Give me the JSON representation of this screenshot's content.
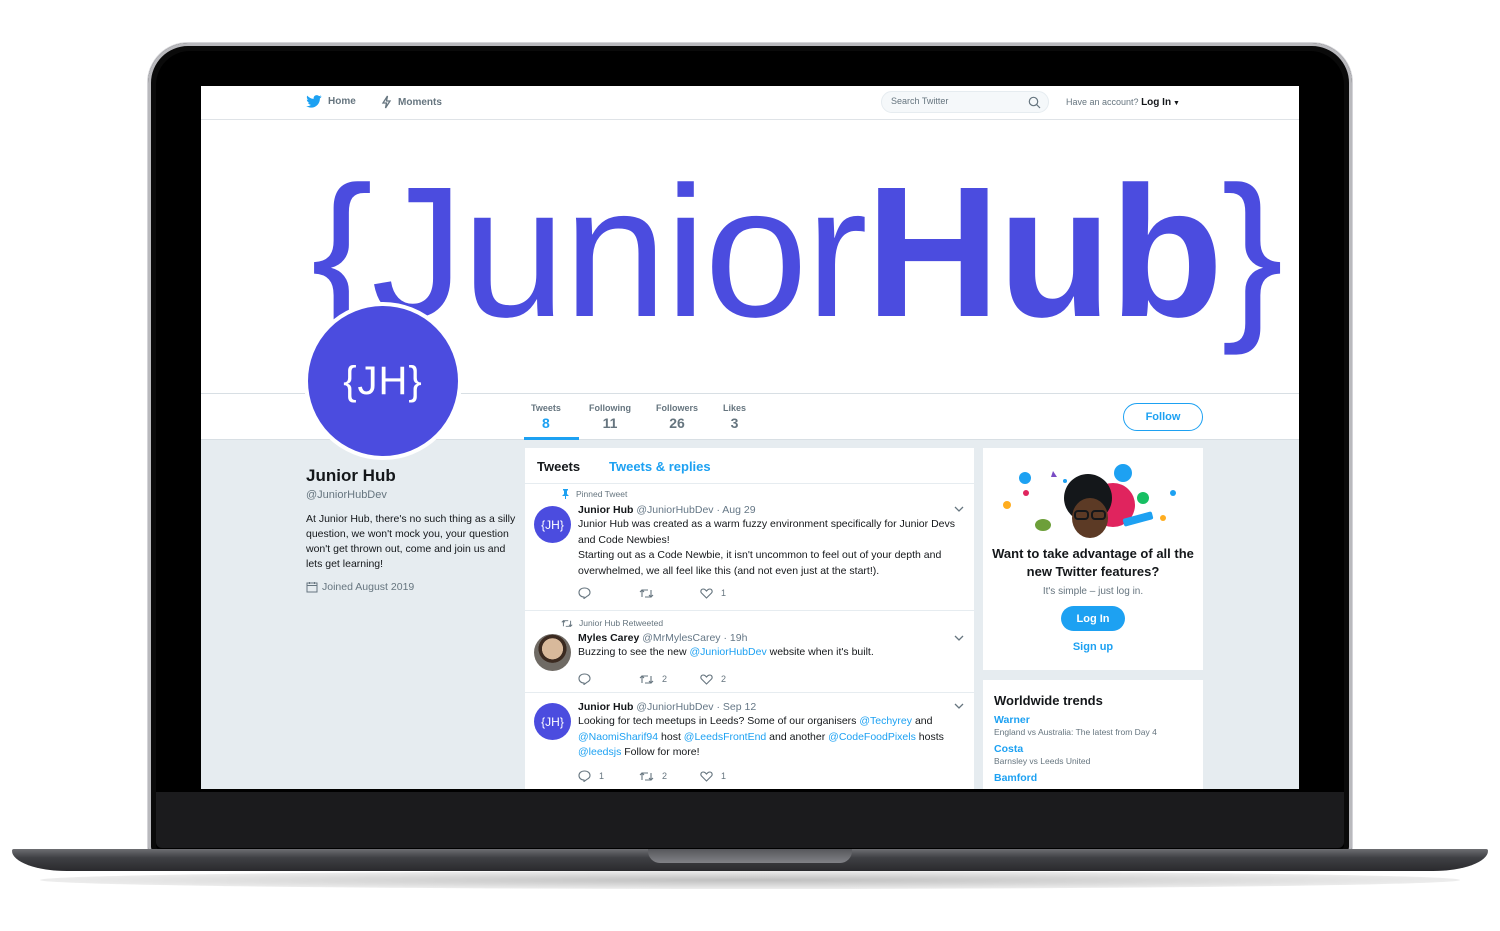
{
  "nav": {
    "home": "Home",
    "moments": "Moments",
    "search_placeholder": "Search Twitter",
    "have_account": "Have an account?",
    "login": "Log In"
  },
  "banner": {
    "brace_open": "{",
    "word_light": "Junior",
    "word_bold": "Hub",
    "brace_close": "}"
  },
  "avatar": {
    "text": "{JH}"
  },
  "profile": {
    "name": "Junior Hub",
    "handle": "@JuniorHubDev",
    "bio": "At Junior Hub, there's no such thing as a silly question, we won't mock you, your question won't get thrown out, come and join us and lets get learning!",
    "joined": "Joined August 2019"
  },
  "stats": [
    {
      "label": "Tweets",
      "value": "8"
    },
    {
      "label": "Following",
      "value": "11"
    },
    {
      "label": "Followers",
      "value": "26"
    },
    {
      "label": "Likes",
      "value": "3"
    }
  ],
  "follow_label": "Follow",
  "timeline": {
    "tab_tweets": "Tweets",
    "tab_replies": "Tweets & replies",
    "tweets": [
      {
        "context": "Pinned Tweet",
        "avatar": "{JH}",
        "name": "Junior Hub",
        "handle": "@JuniorHubDev",
        "time": "· Aug 29",
        "line1": "Junior Hub was created as a warm fuzzy environment specifically for Junior Devs and Code Newbies!",
        "line2": "Starting out as a Code Newbie, it isn't uncommon to feel out of your depth and overwhelmed, we all feel like this (and not even just at the start!).",
        "replies": "",
        "retweets": "",
        "likes": "1"
      },
      {
        "context": "Junior Hub Retweeted",
        "name": "Myles Carey",
        "handle": "@MrMylesCarey",
        "time": "· 19h",
        "pre": "Buzzing to see the new ",
        "mention": "@JuniorHubDev",
        "post": " website when it's built.",
        "replies": "",
        "retweets": "2",
        "likes": "2"
      },
      {
        "avatar": "{JH}",
        "name": "Junior Hub",
        "handle": "@JuniorHubDev",
        "time": "· Sep 12",
        "t1": "Looking for tech meetups in Leeds? Some of our organisers ",
        "m1": "@Techyrey",
        "t2": " and ",
        "m2": "@NaomiSharif94",
        "t3": " host ",
        "m3": "@LeedsFrontEnd",
        "t4": " and another ",
        "m4": "@CodeFoodPixels",
        "t5": " hosts ",
        "m5": "@leedsjs",
        "t6": " Follow for more!",
        "replies": "1",
        "retweets": "2",
        "likes": "1"
      }
    ]
  },
  "promo": {
    "title": "Want to take advantage of all the new Twitter features?",
    "sub": "It's simple – just log in.",
    "login": "Log In",
    "signup": "Sign up"
  },
  "trends": {
    "title": "Worldwide trends",
    "items": [
      {
        "name": "Warner",
        "desc": "England vs Australia: The latest from Day 4"
      },
      {
        "name": "Costa",
        "desc": "Barnsley vs Leeds United"
      },
      {
        "name": "Bamford",
        "desc": ""
      }
    ]
  },
  "colors": {
    "brand_purple": "#4b4cdf",
    "twitter_blue": "#1da1f2",
    "timeline_bg": "#e6ecf0"
  }
}
